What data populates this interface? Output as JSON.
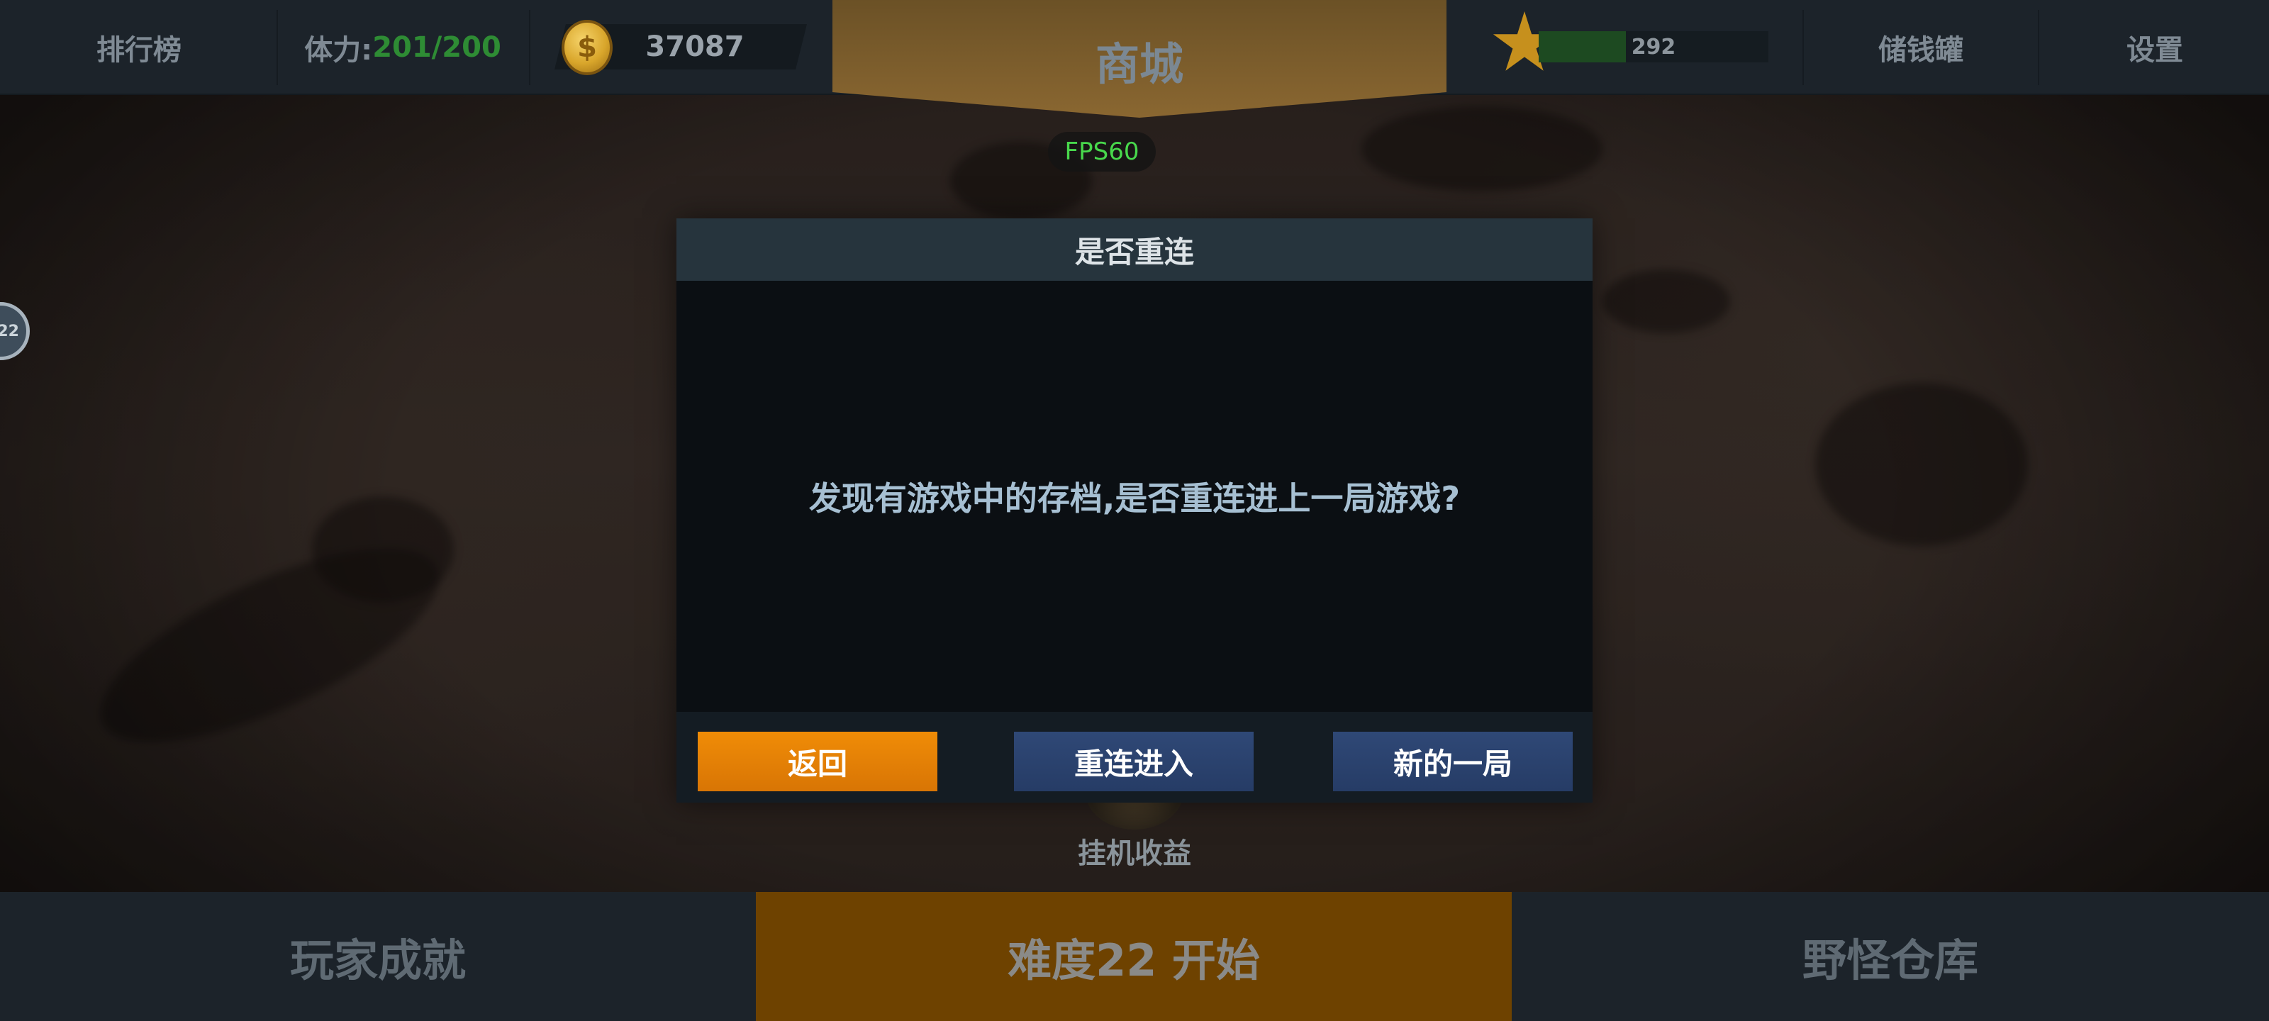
{
  "topbar": {
    "ranking_label": "排行榜",
    "stamina_label": "体力:",
    "stamina_value": "201/200",
    "coins": "37087",
    "shop_label": "商城",
    "xp_value": "292",
    "xp_progress_fraction": 0.38,
    "piggy_bank_label": "储钱罐",
    "settings_label": "设置"
  },
  "fps": "FPS60",
  "side_badge": "22",
  "idle_income_label": "挂机收益",
  "bottombar": {
    "achievements_label": "玩家成就",
    "start_label": "难度22 开始",
    "monster_warehouse_label": "野怪仓库"
  },
  "dialog": {
    "title": "是否重连",
    "message": "发现有游戏中的存档,是否重连进上一局游戏?",
    "back_button": "返回",
    "reconnect_button": "重连进入",
    "new_game_button": "新的一局"
  },
  "colors": {
    "stamina_value": "#2e8c34",
    "fps_text": "#48d84c",
    "back_button": "#e47e05",
    "blue_button": "#2b4270",
    "start_button_bg": "#6e4200",
    "shop_tab": "#8a6731"
  },
  "icons": {
    "coin": "coin-icon",
    "star": "star-icon",
    "idle_income": "treasure-icon"
  }
}
